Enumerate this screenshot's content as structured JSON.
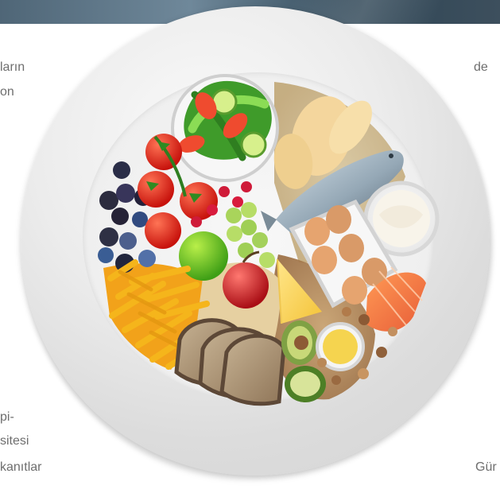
{
  "text_fragments": {
    "left_line_1": "ların",
    "left_line_2": "on",
    "right_line_1": "de",
    "left_bottom_1": "pi-",
    "left_bottom_2": "sitesi",
    "left_bottom_3": "kanıtlar",
    "right_bottom_1": "Gür"
  },
  "image": {
    "subject": "plate-with-mixed-healthy-foods",
    "plate_color": "#e7e7e7",
    "banner_color": "#536b7d"
  }
}
